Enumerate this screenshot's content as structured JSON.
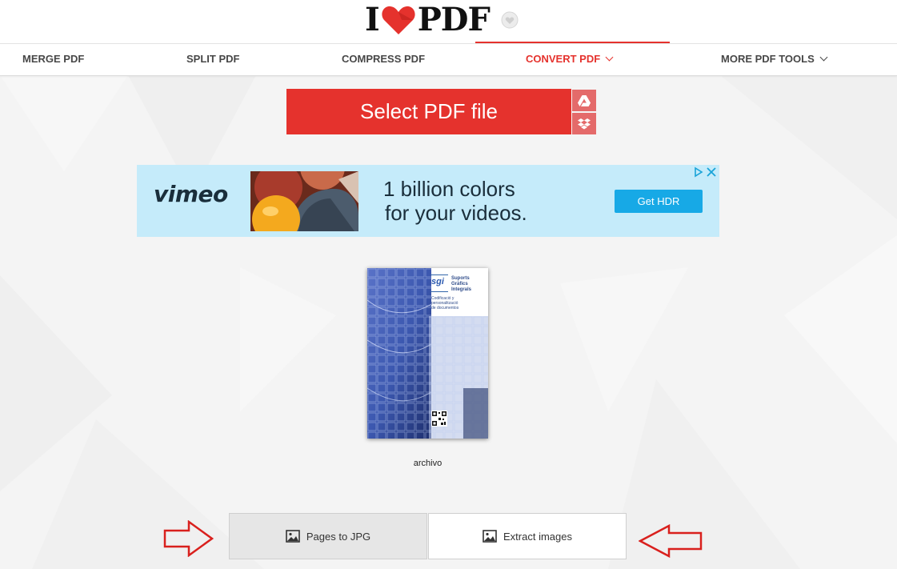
{
  "header": {
    "logo": {
      "left": "I",
      "right": "PDF",
      "heart_icon": "heart-icon",
      "badge_icon": "heart-badge-icon"
    }
  },
  "nav": {
    "items": [
      {
        "label": "MERGE PDF",
        "active": false,
        "dropdown": false
      },
      {
        "label": "SPLIT PDF",
        "active": false,
        "dropdown": false
      },
      {
        "label": "COMPRESS PDF",
        "active": false,
        "dropdown": false
      },
      {
        "label": "CONVERT PDF",
        "active": true,
        "dropdown": true
      },
      {
        "label": "MORE PDF TOOLS",
        "active": false,
        "dropdown": true
      }
    ]
  },
  "upload": {
    "select_label": "Select PDF file",
    "google_drive_icon": "google-drive-icon",
    "dropbox_icon": "dropbox-icon"
  },
  "ad": {
    "brand": "vimeo",
    "headline_line1": "1 billion colors",
    "headline_line2": "for your videos.",
    "cta": "Get HDR",
    "adchoices_icon": "adchoices-icon",
    "close_icon": "close-icon"
  },
  "file": {
    "name": "archivo",
    "thumbnail": {
      "logo": "sgi",
      "brand_line1": "Suports",
      "brand_line2": "Gràfics",
      "brand_line3": "Integrals",
      "sub_line1": "Codificació y",
      "sub_line2": "personalització",
      "sub_line3": "de documentos"
    }
  },
  "options": [
    {
      "label": "Pages to JPG",
      "selected": true,
      "icon": "image-icon"
    },
    {
      "label": "Extract images",
      "selected": false,
      "icon": "image-icon"
    }
  ],
  "colors": {
    "brand_red": "#e5322d",
    "cloud_button": "#e46a6a",
    "ad_background": "#c5ebfa",
    "ad_cta": "#17a9e6",
    "option_selected": "#e6e6e6",
    "option_default": "#ffffff"
  }
}
